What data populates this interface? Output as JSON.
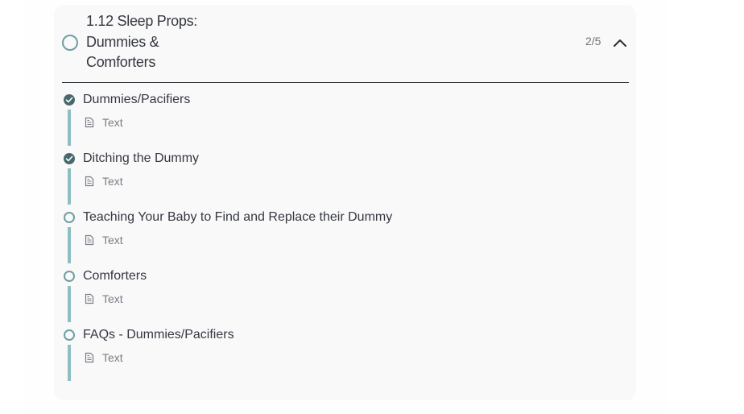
{
  "section": {
    "title": "1.12 Sleep Props: Dummies & Comforters",
    "progress": "2/5",
    "colors": {
      "accent_teal": "#8cbfc3",
      "circle_outline": "#6f9ea3",
      "completed_fill": "#49686d",
      "text_primary": "#353841",
      "text_secondary": "#7a7d84"
    },
    "toggle_icon": "chevron-up-icon"
  },
  "lessons": [
    {
      "title": "Dummies/Pacifiers",
      "type": "Text",
      "completed": true
    },
    {
      "title": "Ditching the Dummy",
      "type": "Text",
      "completed": true
    },
    {
      "title": "Teaching Your Baby to Find and Replace their Dummy",
      "type": "Text",
      "completed": false
    },
    {
      "title": "Comforters",
      "type": "Text",
      "completed": false
    },
    {
      "title": "FAQs - Dummies/Pacifiers",
      "type": "Text",
      "completed": false
    }
  ]
}
